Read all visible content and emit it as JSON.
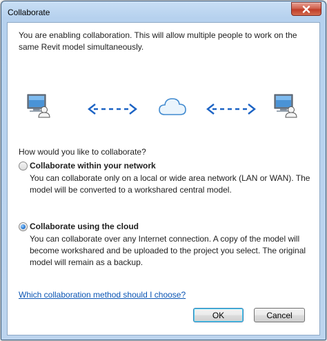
{
  "window": {
    "title": "Collaborate"
  },
  "intro": {
    "text": "You are enabling collaboration. This will allow multiple people to work on the same Revit model simultaneously."
  },
  "illustration": {
    "left_icon": "computer-user-icon",
    "right_icon": "computer-user-icon",
    "center_icon": "cloud-icon",
    "arrow_icon": "bidirectional-dashed-arrow-icon",
    "arrow_color": "#1c63c4"
  },
  "question": "How would you like to collaborate?",
  "options": [
    {
      "title": "Collaborate within your network",
      "description": "You can collaborate only on a local or wide area network (LAN or WAN). The model will be converted to a workshared central model.",
      "selected": false
    },
    {
      "title": "Collaborate using the cloud",
      "description": "You can collaborate over any Internet connection. A copy of the model will become workshared and be uploaded to the project you select. The original model will remain as a backup.",
      "selected": true
    }
  ],
  "help_link": "Which collaboration method should I choose?",
  "buttons": {
    "ok": "OK",
    "cancel": "Cancel"
  },
  "colors": {
    "link": "#0b55b4",
    "titlebar": "#b6d1ee",
    "close_button": "#c03d28"
  }
}
